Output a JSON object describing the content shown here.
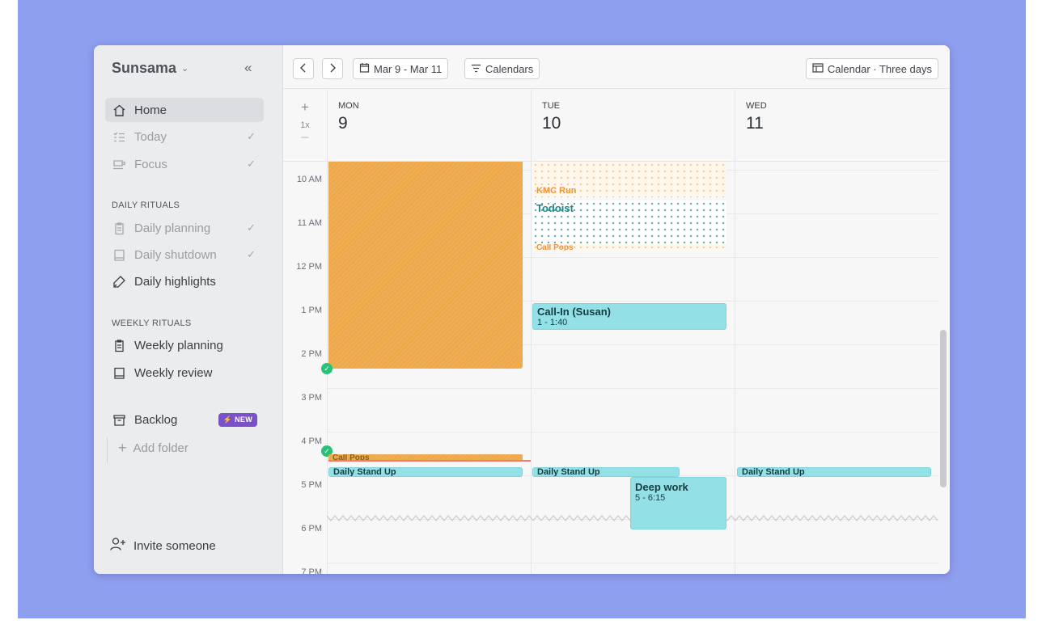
{
  "app": {
    "name": "Sunsama"
  },
  "sidebar": {
    "collapse_icon": "double-chevron-left-icon",
    "nav": [
      {
        "label": "Home",
        "icon": "home-icon",
        "active": true
      },
      {
        "label": "Today",
        "icon": "checklist-icon",
        "checked": true
      },
      {
        "label": "Focus",
        "icon": "coffee-icon",
        "checked": true
      }
    ],
    "daily_rituals_label": "DAILY RITUALS",
    "daily_rituals": [
      {
        "label": "Daily planning",
        "icon": "clipboard-icon",
        "checked": true
      },
      {
        "label": "Daily shutdown",
        "icon": "book-icon",
        "checked": true
      },
      {
        "label": "Daily highlights",
        "icon": "highlighter-icon",
        "checked": false
      }
    ],
    "weekly_rituals_label": "WEEKLY RITUALS",
    "weekly_rituals": [
      {
        "label": "Weekly planning",
        "icon": "clipboard-icon"
      },
      {
        "label": "Weekly review",
        "icon": "book-icon"
      }
    ],
    "backlog": {
      "label": "Backlog",
      "icon": "archive-icon",
      "badge": "NEW"
    },
    "add_folder": "Add folder",
    "invite": "Invite someone"
  },
  "toolbar": {
    "prev_icon": "chevron-left-icon",
    "next_icon": "chevron-right-icon",
    "date_range": "Mar 9 - Mar 11",
    "calendars_label": "Calendars",
    "view_label": "Calendar · Three days"
  },
  "calendar": {
    "zoom_plus": "+",
    "zoom_level": "1x",
    "zoom_minus": "–",
    "days": [
      {
        "dow": "MON",
        "num": "9"
      },
      {
        "dow": "TUE",
        "num": "10"
      },
      {
        "dow": "WED",
        "num": "11"
      }
    ],
    "hours": [
      "10 AM",
      "11 AM",
      "12 PM",
      "1 PM",
      "2 PM",
      "3 PM",
      "4 PM",
      "5 PM",
      "6 PM",
      "7 PM"
    ],
    "events": {
      "kmc_run": "KMC Run",
      "todoist": "Todoist",
      "call_pops_tue": "Call Pops",
      "call_in_title": "Call-In (Susan)",
      "call_in_time": "1 - 1:40",
      "call_pops_mon": "Call Pops",
      "standup_mon": "Daily Stand Up",
      "standup_tue": "Daily Stand Up",
      "standup_wed": "Daily Stand Up",
      "deep_work_title": "Deep work",
      "deep_work_time": "5 - 6:15"
    }
  },
  "colors": {
    "backdrop": "#8f9ff0",
    "event_teal": "#93e1e6",
    "event_orange": "#f1a948",
    "badge_purple": "#7a51c8",
    "done_green": "#29c178",
    "now_line": "#ef7b6b"
  }
}
